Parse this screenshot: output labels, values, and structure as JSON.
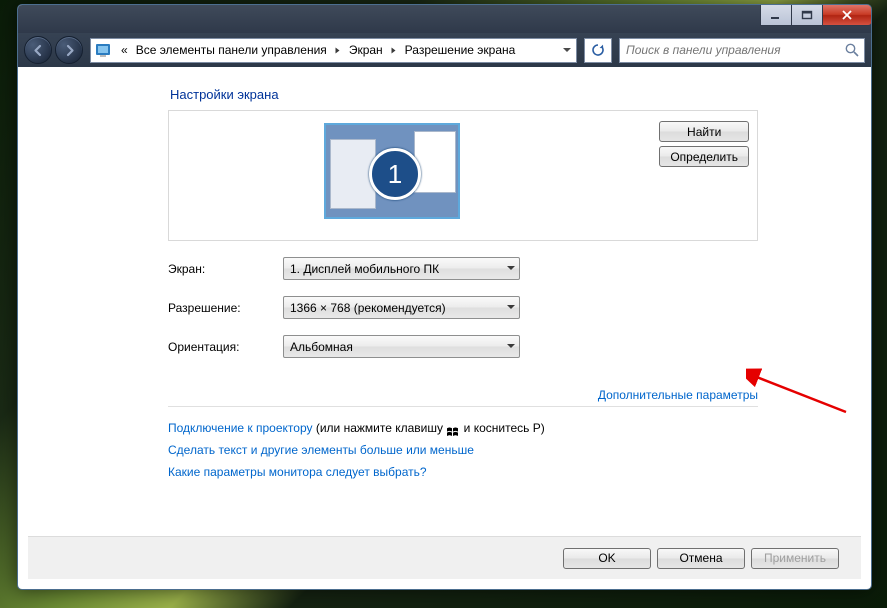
{
  "breadcrumb": {
    "prefix": "«",
    "items": [
      "Все элементы панели управления",
      "Экран",
      "Разрешение экрана"
    ]
  },
  "search": {
    "placeholder": "Поиск в панели управления"
  },
  "heading": "Настройки экрана",
  "monitor_id": "1",
  "side_buttons": {
    "detect": "Найти",
    "identify": "Определить"
  },
  "fields": {
    "display": {
      "label": "Экран:",
      "value": "1. Дисплей мобильного ПК"
    },
    "resolution": {
      "label": "Разрешение:",
      "value": "1366 × 768 (рекомендуется)"
    },
    "orientation": {
      "label": "Ориентация:",
      "value": "Альбомная"
    }
  },
  "advanced_link": "Дополнительные параметры",
  "projector": {
    "link": "Подключение к проектору",
    "tail1": " (или нажмите клавишу ",
    "tail2": " и коснитесь P)"
  },
  "size_link": "Сделать текст и другие элементы больше или меньше",
  "which_link": "Какие параметры монитора следует выбрать?",
  "footer": {
    "ok": "OK",
    "cancel": "Отмена",
    "apply": "Применить"
  }
}
